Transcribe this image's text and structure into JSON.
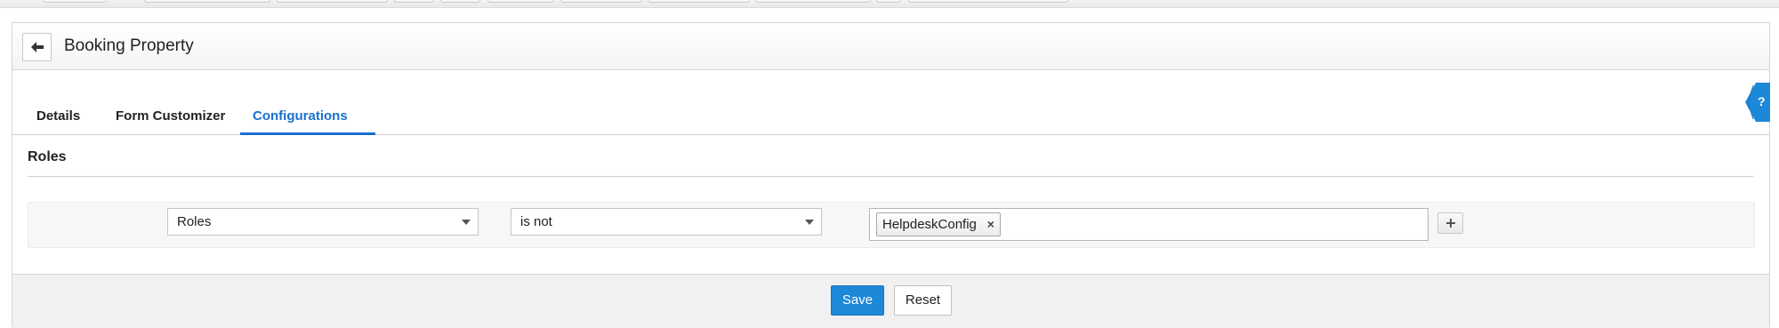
{
  "header": {
    "title": "Booking Property",
    "back_icon": "arrow-left-icon"
  },
  "tabs": [
    {
      "label": "Details",
      "active": false
    },
    {
      "label": "Form Customizer",
      "active": false
    },
    {
      "label": "Configurations",
      "active": true
    }
  ],
  "help": {
    "label": "?",
    "icon": "help-icon"
  },
  "section": {
    "title": "Roles"
  },
  "condition": {
    "field": "Roles",
    "operator": "is not",
    "values": [
      "HelpdeskConfig"
    ],
    "tag_remove_label": "×",
    "add_icon": "plus-icon"
  },
  "footer": {
    "save_label": "Save",
    "reset_label": "Reset"
  },
  "colors": {
    "accent": "#1a6fcf",
    "save_button": "#1e88d8",
    "help_tab": "#1e88d8"
  }
}
